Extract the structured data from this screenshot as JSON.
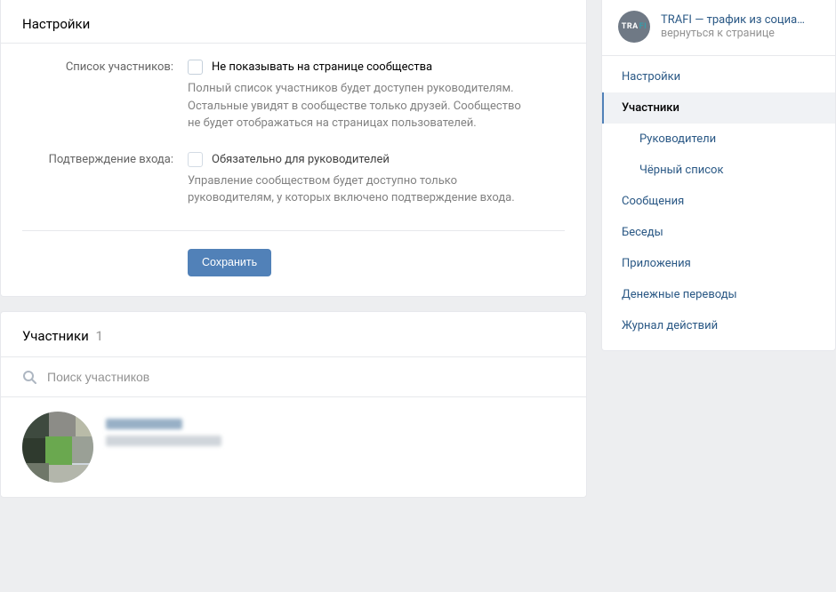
{
  "settings": {
    "title": "Настройки",
    "member_list": {
      "label": "Список участников:",
      "checkbox_label": "Не показывать на странице сообщества",
      "desc": "Полный список участников будет доступен руководителям. Остальные увидят в сообществе только друзей. Сообщество не будет отображаться на страницах пользователей."
    },
    "login_confirm": {
      "label": "Подтверждение входа:",
      "checkbox_label": "Обязательно для руководителей",
      "desc": "Управление сообществом будет доступно только руководителям, у которых включено подтверждение входа."
    },
    "save_label": "Сохранить"
  },
  "members": {
    "title": "Участники",
    "count": "1",
    "search_placeholder": "Поиск участников"
  },
  "sidebar": {
    "community_title": "TRAFI — трафик из социа…",
    "back_label": "вернуться к странице",
    "nav": {
      "settings": "Настройки",
      "members": "Участники",
      "managers": "Руководители",
      "blacklist": "Чёрный список",
      "messages": "Сообщения",
      "conversations": "Беседы",
      "apps": "Приложения",
      "money_transfers": "Денежные переводы",
      "action_log": "Журнал действий"
    }
  }
}
